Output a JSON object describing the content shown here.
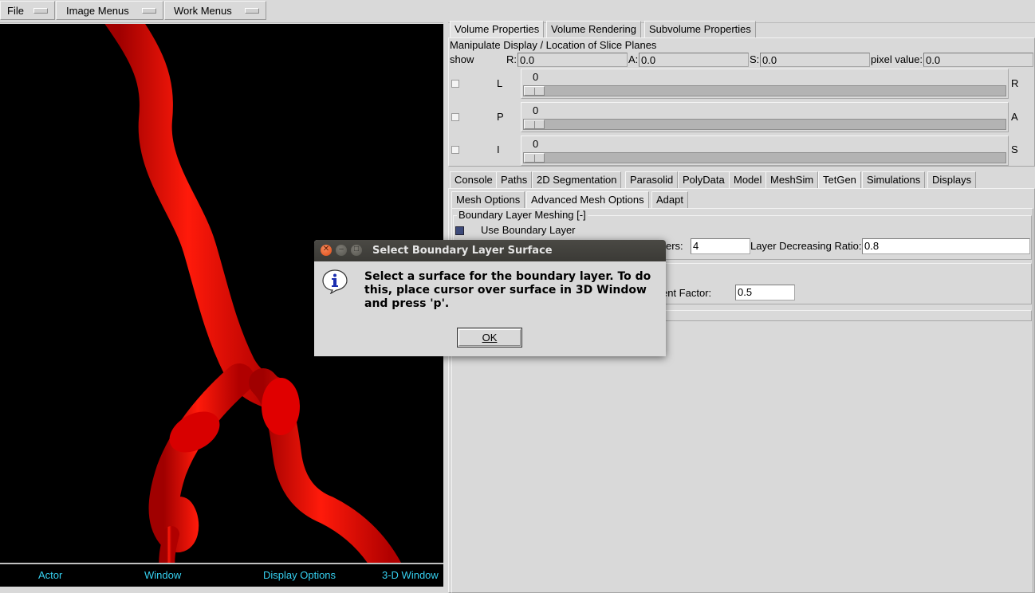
{
  "menubar": {
    "items": [
      {
        "label": "File"
      },
      {
        "label": "Image Menus"
      },
      {
        "label": "Work Menus"
      }
    ]
  },
  "viewer": {
    "bar": [
      "Actor",
      "Window",
      "Display Options",
      "3-D Window"
    ],
    "vessel_color": "#ff0000",
    "background": "#000000",
    "accent": "#35d0f0"
  },
  "volume_tabs": [
    "Volume Properties",
    "Volume Rendering",
    "Subvolume Properties"
  ],
  "slice_panel": {
    "title": "Manipulate Display / Location of Slice Planes",
    "show_label": "show",
    "r_label": "R:",
    "r_value": "0.0",
    "a_label": "A:",
    "a_value": "0.0",
    "s_label": "S:",
    "s_value": "0.0",
    "pixel_label": "pixel value:",
    "pixel_value": "0.0",
    "sliders": [
      {
        "left": "L",
        "right": "R",
        "value": "0"
      },
      {
        "left": "P",
        "right": "A",
        "value": "0"
      },
      {
        "left": "I",
        "right": "S",
        "value": "0"
      }
    ]
  },
  "main_tabs": [
    "Console",
    "Paths",
    "2D Segmentation",
    "Parasolid",
    "PolyData",
    "Model",
    "MeshSim",
    "TetGen",
    "Simulations",
    "Displays"
  ],
  "sub_tabs": [
    "Mesh Options",
    "Advanced Mesh Options",
    "Adapt"
  ],
  "boundary": {
    "group_title": "Boundary Layer Meshing [-]",
    "use_label": "Use Boundary Layer",
    "layers_label_partial": "ers:",
    "layers_value": "4",
    "ratio_label": "Layer Decreasing Ratio:",
    "ratio_value": "0.8",
    "factor_label_partial": "ent Factor:",
    "factor_value": "0.5"
  },
  "dialog": {
    "title": "Select Boundary Layer Surface",
    "message": "Select a surface for the boundary layer. To do this, place cursor over surface in 3D Window and press 'p'.",
    "ok_label": "OK"
  }
}
